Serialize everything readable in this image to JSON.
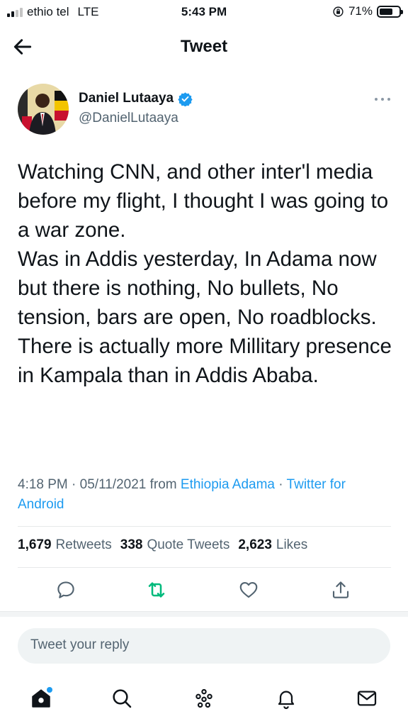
{
  "status_bar": {
    "carrier": "ethio tel",
    "network": "LTE",
    "time": "5:43 PM",
    "battery_text": "71%",
    "battery_level": 0.71
  },
  "header": {
    "title": "Tweet"
  },
  "author": {
    "name": "Daniel Lutaaya",
    "handle": "@DanielLutaaya",
    "verified": true
  },
  "tweet": {
    "lines": [
      "Watching CNN, and other inter'l media before my flight, I thought I was going to a war zone.",
      "Was in Addis yesterday, In Adama now but there is nothing, No bullets, No tension, bars are open, No roadblocks.",
      "There is actually more Millitary presence in Kampala than in Addis Ababa."
    ]
  },
  "meta": {
    "time": "4:18 PM",
    "sep1": " · ",
    "date": "05/11/2021",
    "from": " from ",
    "location": "Ethiopia Adama",
    "sep2": " · ",
    "source": "Twitter for Android"
  },
  "stats": {
    "retweets_count": "1,679",
    "retweets_label": "Retweets",
    "quotes_count": "338",
    "quotes_label": "Quote Tweets",
    "likes_count": "2,623",
    "likes_label": "Likes"
  },
  "reply": {
    "placeholder": "Tweet your reply"
  },
  "colors": {
    "accent": "#1d9bf0",
    "retweet": "#00ba7c",
    "text": "#0f1419",
    "secondary": "#536471"
  },
  "icons": {
    "back": "arrow-left-icon",
    "verified": "verified-badge-icon",
    "more": "more-dots-icon",
    "reply": "comment-icon",
    "retweet": "retweet-icon",
    "like": "heart-icon",
    "share": "share-icon",
    "home": "home-icon",
    "search": "search-icon",
    "spaces": "spaces-icon",
    "notifications": "bell-icon",
    "messages": "mail-icon"
  }
}
